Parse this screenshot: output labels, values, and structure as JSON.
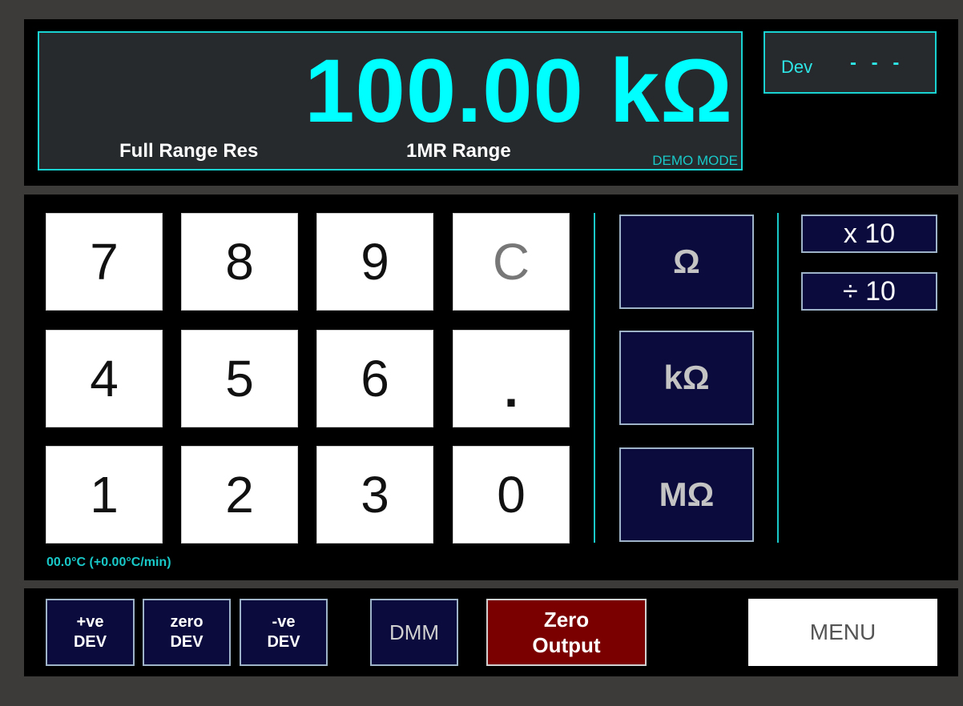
{
  "display": {
    "reading": "100.00 kΩ",
    "function_label": "Full Range Res",
    "range_label": "1MR Range",
    "mode": "DEMO MODE"
  },
  "deviation": {
    "label": "Dev",
    "value": "- - -"
  },
  "keypad": {
    "k7": "7",
    "k8": "8",
    "k9": "9",
    "clear": "C",
    "k4": "4",
    "k5": "5",
    "k6": "6",
    "dot": ".",
    "k1": "1",
    "k2": "2",
    "k3": "3",
    "k0": "0"
  },
  "units": {
    "ohm": "Ω",
    "kohm": "kΩ",
    "mohm": "MΩ"
  },
  "scale": {
    "times10": "x 10",
    "div10": "÷ 10"
  },
  "temperature": "00.0°C (+0.00°C/min)",
  "bottom": {
    "pos_dev_top": "+ve",
    "pos_dev_bottom": "DEV",
    "zero_dev_top": "zero",
    "zero_dev_bottom": "DEV",
    "neg_dev_top": "-ve",
    "neg_dev_bottom": "DEV",
    "dmm": "DMM",
    "zero_output_top": "Zero",
    "zero_output_bottom": "Output",
    "menu": "MENU"
  }
}
